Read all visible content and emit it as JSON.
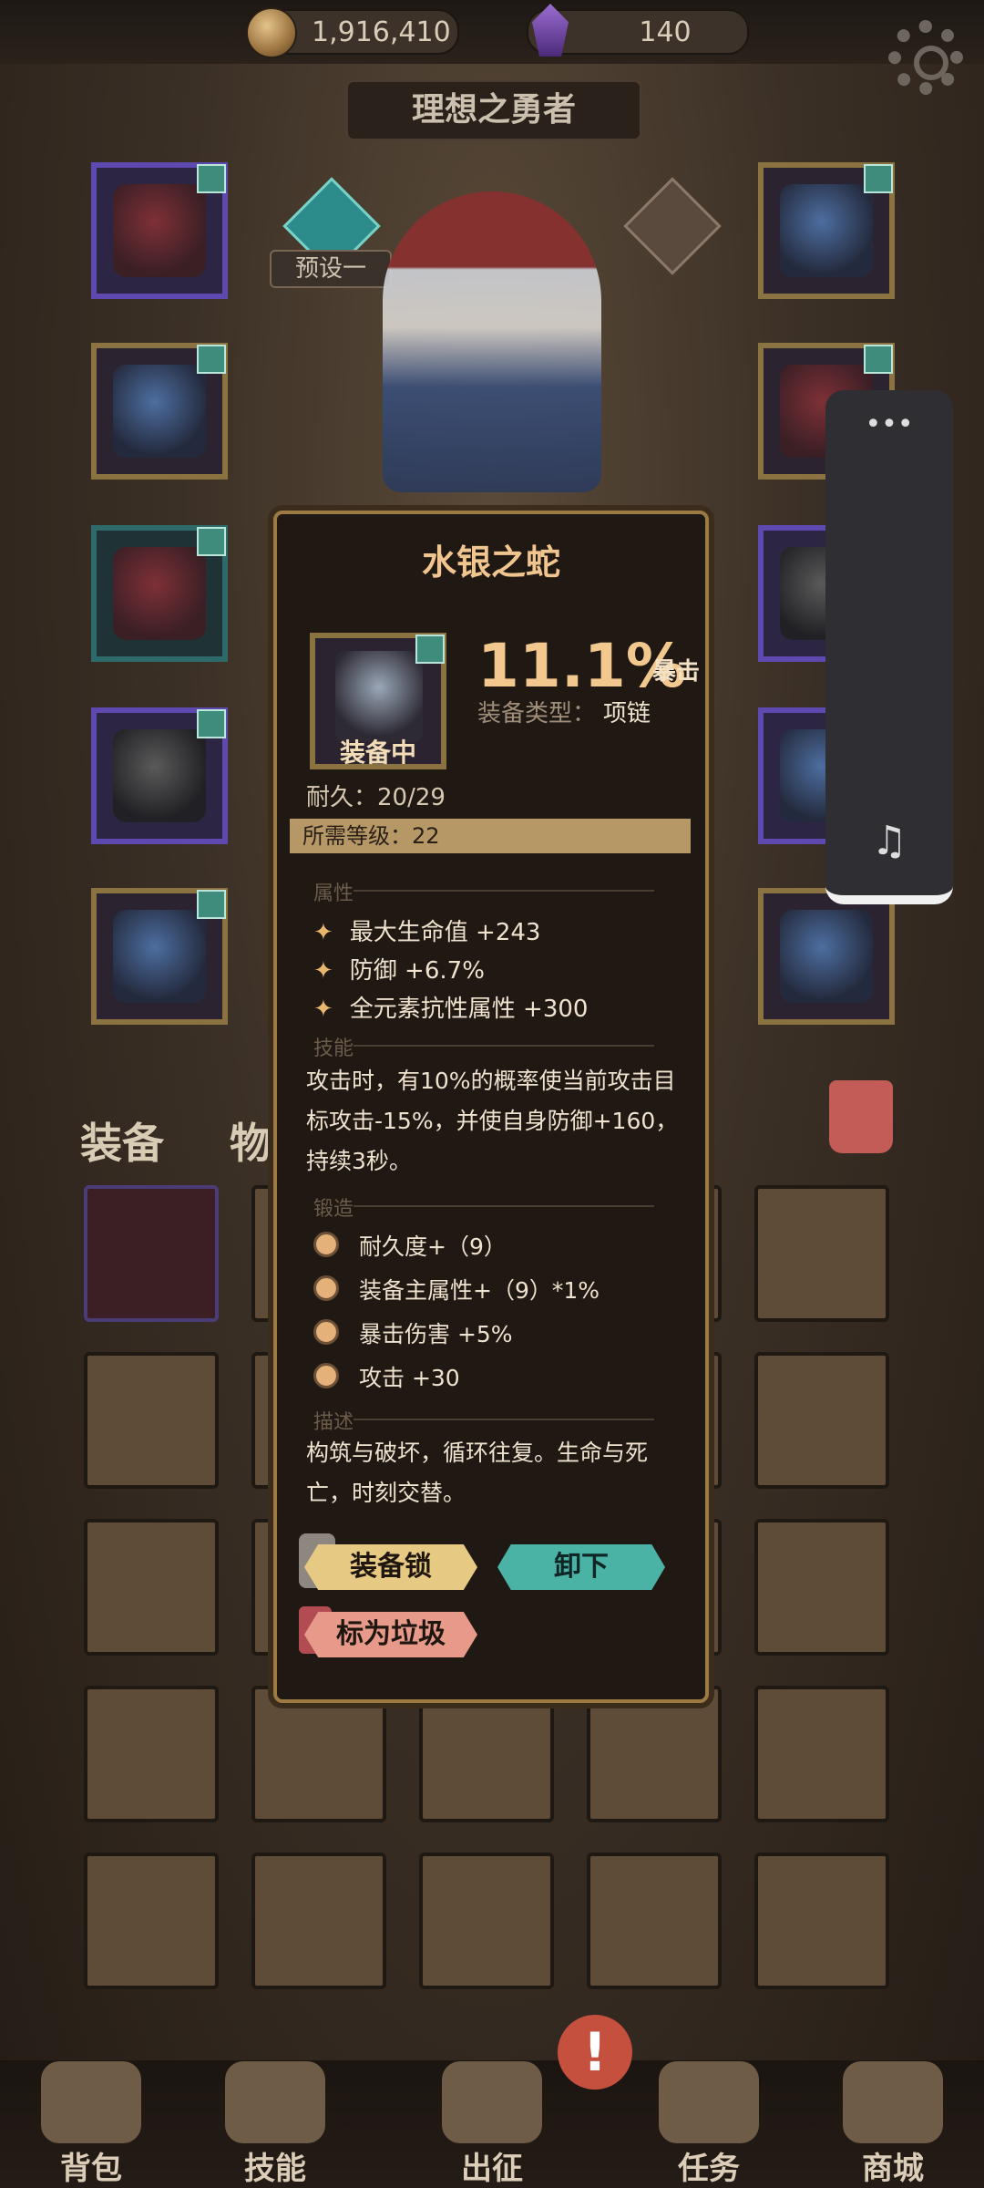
{
  "top_bar": {
    "gold": "1,916,410",
    "gems": "140"
  },
  "hero": {
    "title": "理想之勇者",
    "preset": "预设一"
  },
  "tabs": {
    "equip": "装备",
    "items": "物品"
  },
  "popup": {
    "title": "水银之蛇",
    "equipped_label": "装备中",
    "main_stat_value": "11.1%",
    "main_stat_type": "暴击",
    "type_label": "装备类型：",
    "type_value": "项链",
    "durability": "耐久：20/29",
    "required_level": "所需等级：22",
    "sections": {
      "attributes": "属性",
      "skill": "技能",
      "forge": "锻造",
      "description": "描述"
    },
    "attributes": [
      "最大生命值 +243",
      "防御 +6.7%",
      "全元素抗性属性 +300"
    ],
    "skill_text": "攻击时，有10%的概率使当前攻击目标攻击-15%，并使自身防御+160，持续3秒。",
    "forge": [
      "耐久度+（9）",
      "装备主属性+（9）*1%",
      "暴击伤害 +5%",
      "攻击 +30"
    ],
    "description": "构筑与破坏，循环往复。生命与死亡，时刻交替。",
    "buttons": {
      "lock": "装备锁",
      "unequip": "卸下",
      "mark_trash": "标为垃圾"
    }
  },
  "bottom_nav": [
    "背包",
    "技能",
    "出征",
    "任务",
    "商城"
  ],
  "alert_symbol": "!",
  "music_widget": {
    "menu": "•••",
    "icon": "♫"
  }
}
